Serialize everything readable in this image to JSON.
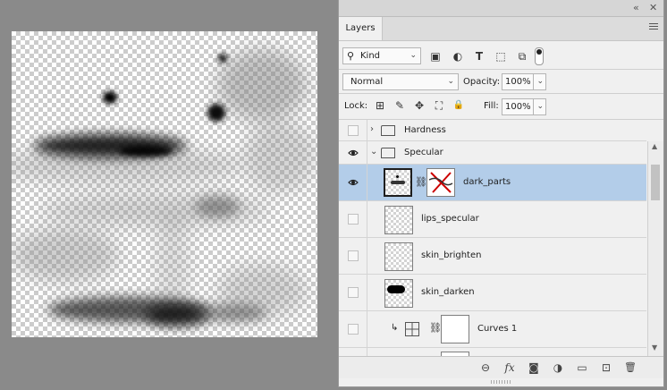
{
  "titlebar": {
    "collapse_icon": "double-chevron-icon",
    "close_icon": "close-icon",
    "collapse_glyph": "«",
    "close_glyph": "✕"
  },
  "tab": {
    "label": "Layers",
    "menu_icon": "hamburger-menu-icon"
  },
  "filter": {
    "kind_label": "Kind",
    "icons": [
      "search-icon",
      "pixel-filter-icon",
      "adjustment-filter-icon",
      "type-filter-icon",
      "shape-filter-icon",
      "smart-object-filter-icon",
      "filter-toggle-icon"
    ],
    "glyphs": {
      "pixel": "▣",
      "adjust": "◐",
      "type": "T",
      "shape": "⬚",
      "smart": "⧉"
    }
  },
  "blend": {
    "mode": "Normal",
    "opacity_label": "Opacity:",
    "opacity_value": "100%"
  },
  "lock": {
    "label": "Lock:",
    "fill_label": "Fill:",
    "fill_value": "100%",
    "icons": [
      "lock-transparent-icon",
      "lock-paint-icon",
      "lock-position-icon",
      "lock-artboard-icon",
      "lock-all-icon"
    ],
    "glyphs": [
      "⊞",
      "✎",
      "✥",
      "⛶",
      "🔒"
    ]
  },
  "layers": [
    {
      "name": "Hardness",
      "type": "group",
      "expanded": false,
      "visible": false
    },
    {
      "name": "Specular",
      "type": "group",
      "expanded": true,
      "visible": true
    },
    {
      "name": "dark_parts",
      "type": "pixel",
      "visible": true,
      "selected": true,
      "has_mask": true
    },
    {
      "name": "lips_specular",
      "type": "pixel",
      "visible": false
    },
    {
      "name": "skin_brighten",
      "type": "pixel",
      "visible": false
    },
    {
      "name": "skin_darken",
      "type": "pixel",
      "visible": false
    },
    {
      "name": "Curves 1",
      "type": "adjustment",
      "visible": false,
      "clipped": true
    }
  ],
  "bottom_icons": [
    "link-layers-icon",
    "fx-icon",
    "add-mask-icon",
    "new-adjustment-icon",
    "new-group-icon",
    "new-layer-icon",
    "trash-icon"
  ],
  "bottom_glyphs": {
    "link": "⊖",
    "fx": "fx",
    "mask": "◙",
    "adjust": "◑",
    "group": "▭",
    "new": "⊡",
    "trash": "🗑"
  }
}
